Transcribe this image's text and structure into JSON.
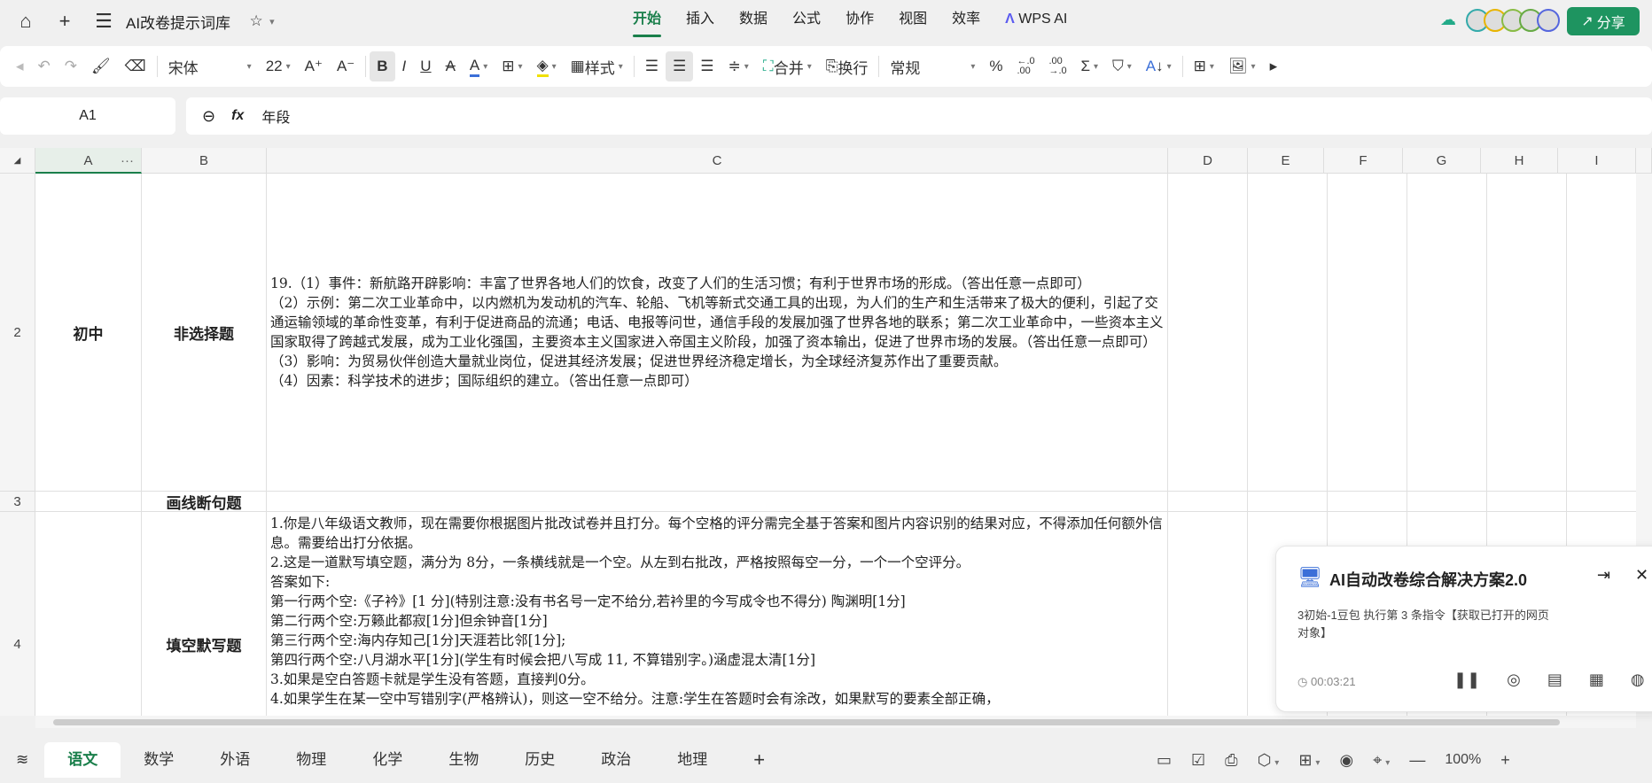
{
  "titlebar": {
    "doc_title": "AI改卷提示词库",
    "menu": [
      "开始",
      "插入",
      "数据",
      "公式",
      "协作",
      "视图",
      "效率",
      "WPS AI"
    ],
    "share": "分享"
  },
  "toolbar": {
    "font": "宋体",
    "size": "22",
    "style": "样式",
    "merge": "合并",
    "wrap": "换行",
    "format": "常规",
    "percent": "%",
    "dec_inc": "←.0 .00",
    "dec_dec": ".00 →.0"
  },
  "formula_bar": {
    "cell_ref": "A1",
    "fx": "fx",
    "value": "年段"
  },
  "columns": [
    "A",
    "B",
    "C",
    "D",
    "E",
    "F",
    "G",
    "H",
    "I"
  ],
  "rows": [
    {
      "num": "2",
      "a": "初中",
      "b": "非选择题",
      "c": "19.（1）事件：新航路开辟影响：丰富了世界各地人们的饮食，改变了人们的生活习惯；有利于世界市场的形成。（答出任意一点即可）\n（2）示例：第二次工业革命中，以内燃机为发动机的汽车、轮船、飞机等新式交通工具的出现，为人们的生产和生活带来了极大的便利，引起了交通运输领域的革命性变革，有利于促进商品的流通；电话、电报等问世，通信手段的发展加强了世界各地的联系；第二次工业革命中，一些资本主义国家取得了跨越式发展，成为工业化强国，主要资本主义国家进入帝国主义阶段，加强了资本输出，促进了世界市场的发展。（答出任意一点即可）\n（3）影响：为贸易伙伴创造大量就业岗位，促进其经济发展；促进世界经济稳定增长，为全球经济复苏作出了重要贡献。\n（4）因素：科学技术的进步；国际组织的建立。（答出任意一点即可）"
    },
    {
      "num": "3",
      "a": "",
      "b": "画线断句题",
      "c": ""
    },
    {
      "num": "4",
      "a": "",
      "b": "填空默写题",
      "c": "1.你是八年级语文教师，现在需要你根据图片批改试卷并且打分。每个空格的评分需完全基于答案和图片内容识别的结果对应，不得添加任何额外信息。需要给出打分依据。\n2.这是一道默写填空题，满分为 8分，一条横线就是一个空。从左到右批改，严格按照每空一分，一个一个空评分。\n答案如下:\n第一行两个空:《子衿》[1 分](特别注意:没有书名号一定不给分,若衿里的今写成令也不得分) 陶渊明[1分]\n第二行两个空:万籁此都寂[1分]但余钟音[1分]\n第三行两个空:海内存知己[1分]天涯若比邻[1分];\n第四行两个空:八月湖水平[1分](学生有时候会把八写成 11, 不算错别字。)涵虚混太清[1分]\n3.如果是空白答题卡就是学生没有答题，直接判0分。\n4.如果学生在某一空中写错别字(严格辨认)，则这一空不给分。注意:学生在答题时会有涂改，如果默写的要素全部正确，"
    }
  ],
  "sheets": [
    "语文",
    "数学",
    "外语",
    "物理",
    "化学",
    "生物",
    "历史",
    "政治",
    "地理"
  ],
  "zoom": "100%",
  "dialog": {
    "title": "AI自动改卷综合解决方案2.0",
    "message": "3初始-1豆包 执行第 3 条指令【获取已打开的网页对象】",
    "timer": "00:03:21"
  },
  "colors": {
    "accent": "#1a7f4b",
    "share": "#1e9460"
  }
}
